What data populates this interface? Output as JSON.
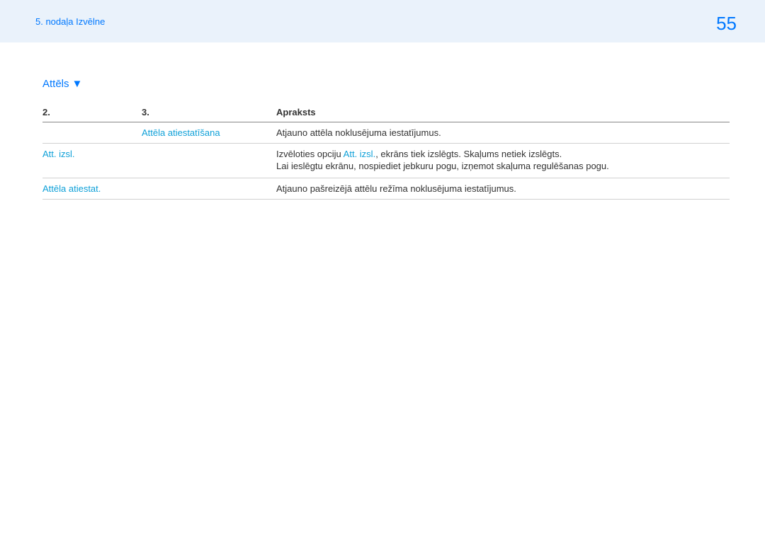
{
  "header": {
    "breadcrumb": "5. nodaļa Izvēlne",
    "page_number": "55"
  },
  "section": {
    "title": "Attēls",
    "triangle": "▼"
  },
  "table": {
    "headers": {
      "col2": "2.",
      "col3": "3.",
      "desc": "Apraksts"
    },
    "rows": [
      {
        "col2": "",
        "col3": "Attēla atiestatīšana",
        "desc": [
          "Atjauno attēla noklusējuma iestatījumus."
        ]
      },
      {
        "col2": "Att. izsl.",
        "col3": "",
        "desc_prefix": "Izvēloties opciju ",
        "desc_inline": "Att. izsl.",
        "desc_suffix": ", ekrāns tiek izslēgts. Skaļums netiek izslēgts.",
        "desc_line2": "Lai ieslēgtu ekrānu, nospiediet jebkuru pogu, izņemot skaļuma regulēšanas pogu."
      },
      {
        "col2": "Attēla atiestat.",
        "col3": "",
        "desc": [
          "Atjauno pašreizējā attēlu režīma noklusējuma iestatījumus."
        ]
      }
    ]
  }
}
